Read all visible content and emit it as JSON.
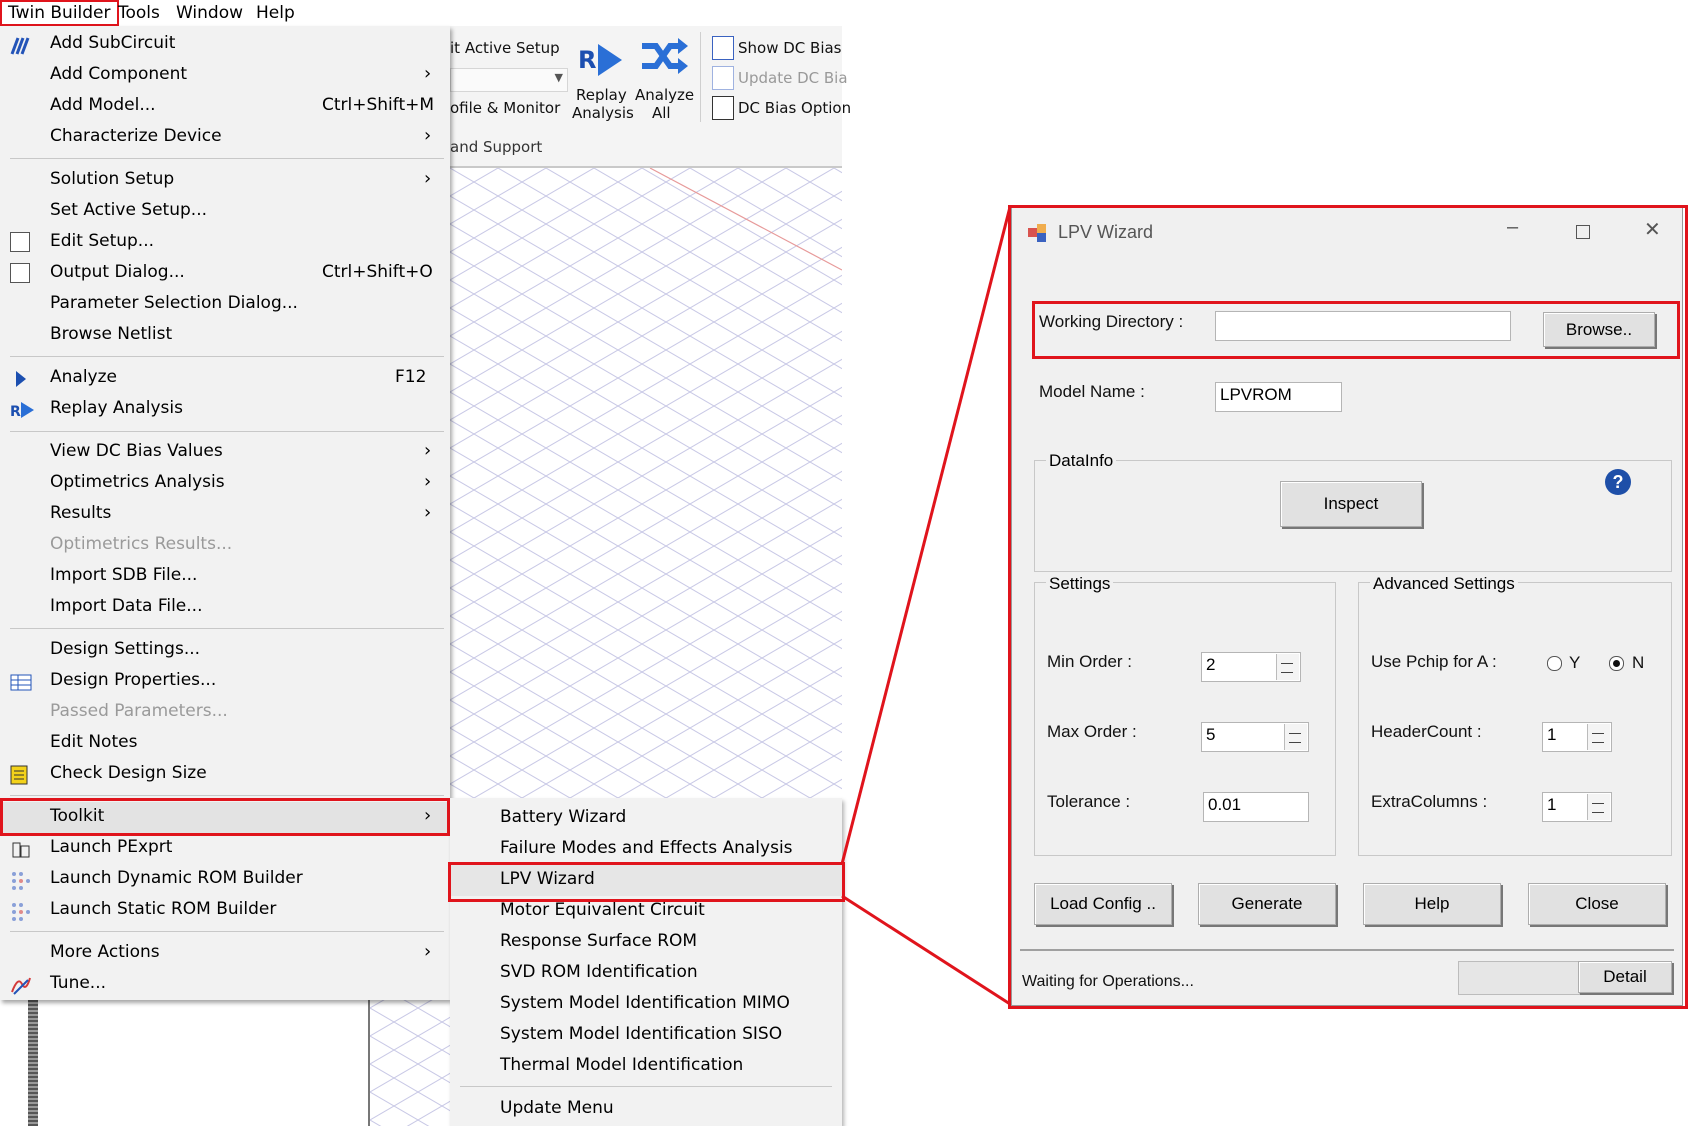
{
  "menubar": {
    "items": [
      "Twin Builder",
      "Tools",
      "Window",
      "Help"
    ]
  },
  "ribbon": {
    "active_setup": "it Active Setup",
    "profile_monitor": "ofile & Monitor",
    "replay_label": "Replay",
    "replay_sub": "Analysis",
    "analyze_label": "Analyze",
    "analyze_sub": "All",
    "show_dc_bias": "Show DC Bias",
    "update_dc_bias": "Update DC Bia",
    "dc_bias_options": "DC Bias Option",
    "group_label": "and Support"
  },
  "menu": {
    "add_subcircuit": "Add SubCircuit",
    "add_component": "Add Component",
    "add_model": "Add Model...",
    "add_model_shortcut": "Ctrl+Shift+M",
    "characterize_device": "Characterize Device",
    "solution_setup": "Solution Setup",
    "set_active_setup": "Set Active Setup...",
    "edit_setup": "Edit Setup...",
    "output_dialog": "Output Dialog...",
    "output_dialog_shortcut": "Ctrl+Shift+O",
    "parameter_selection": "Parameter Selection Dialog...",
    "browse_netlist": "Browse Netlist",
    "analyze": "Analyze",
    "analyze_shortcut": "F12",
    "replay_analysis": "Replay Analysis",
    "view_dc_bias": "View DC Bias Values",
    "optimetrics_analysis": "Optimetrics Analysis",
    "results": "Results",
    "optimetrics_results": "Optimetrics Results...",
    "import_sdb": "Import SDB File...",
    "import_data": "Import Data File...",
    "design_settings": "Design Settings...",
    "design_properties": "Design Properties...",
    "passed_parameters": "Passed Parameters...",
    "edit_notes": "Edit Notes",
    "check_design_size": "Check Design Size",
    "toolkit": "Toolkit",
    "launch_pexprt": "Launch PExprt",
    "launch_dynamic_rom": "Launch Dynamic ROM Builder",
    "launch_static_rom": "Launch Static ROM Builder",
    "more_actions": "More Actions",
    "tune": "Tune..."
  },
  "submenu": {
    "items": [
      "Battery Wizard",
      "Failure Modes and Effects Analysis",
      "LPV Wizard",
      "Motor Equivalent Circuit",
      "Response Surface ROM",
      "SVD ROM Identification",
      "System Model Identification MIMO",
      "System Model Identification SISO",
      "Thermal Model Identification"
    ],
    "update_menu": "Update Menu"
  },
  "dialog": {
    "title": "LPV Wizard",
    "working_directory_label": "Working Directory :",
    "working_directory_value": "",
    "browse_button": "Browse..",
    "model_name_label": "Model Name :",
    "model_name_value": "LPVROM",
    "datainfo_group": "DataInfo",
    "inspect_button": "Inspect",
    "settings_group": "Settings",
    "min_order_label": "Min Order :",
    "min_order_value": "2",
    "max_order_label": "Max Order :",
    "max_order_value": "5",
    "tolerance_label": "Tolerance :",
    "tolerance_value": "0.01",
    "advanced_group": "Advanced Settings",
    "use_pchip_label": "Use Pchip for A :",
    "radio_y": "Y",
    "radio_n": "N",
    "pchip_selected": "N",
    "headercount_label": "HeaderCount :",
    "headercount_value": "1",
    "extracolumns_label": "ExtraColumns :",
    "extracolumns_value": "1",
    "load_config_button": "Load Config ..",
    "generate_button": "Generate",
    "help_button": "Help",
    "close_button": "Close",
    "status_text": "Waiting for Operations...",
    "detail_button": "Detail"
  },
  "colors": {
    "highlight": "#e0141c",
    "menu_bg": "#f2f2f2",
    "dialog_bg": "#f0f0f0",
    "help_icon": "#1e4fa8"
  }
}
